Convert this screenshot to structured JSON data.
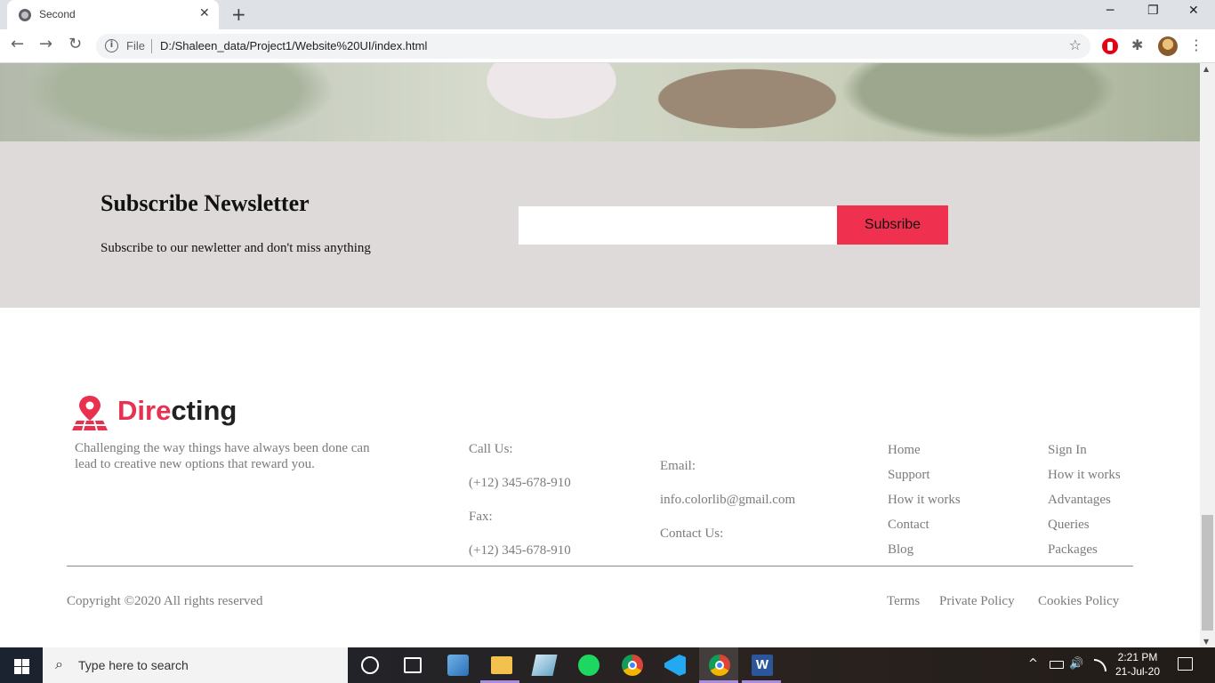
{
  "browser": {
    "tab_title": "Second",
    "tab_close": "✕",
    "new_tab": "+",
    "window": {
      "minimize": "─",
      "restore": "❐",
      "close": "✕"
    },
    "nav": {
      "back": "←",
      "forward": "→",
      "reload": "↻"
    },
    "address": {
      "scheme_label": "File",
      "url": "D:/Shaleen_data/Project1/Website%20UI/index.html",
      "star": "☆"
    },
    "extensions": {
      "puzzle": "✱",
      "menu": "⋮"
    }
  },
  "newsletter": {
    "title": "Subscribe Newsletter",
    "subtitle": "Subscribe to our newletter and don't miss anything",
    "input_value": "",
    "button_label": "Subsribe",
    "button_color": "#f0304f",
    "background": "#dedad9"
  },
  "footer": {
    "brand": {
      "part_accent": "Dire",
      "part_dark": "cting",
      "accent_color": "#e9304f"
    },
    "tagline": "Challenging the way things have always been done can lead to creative new options that reward you.",
    "call": {
      "label": "Call Us:",
      "phone": "(+12) 345-678-910",
      "fax_label": "Fax:",
      "fax": "(+12) 345-678-910"
    },
    "email": {
      "label": "Email:",
      "address": "info.colorlib@gmail.com",
      "contact_label": "Contact Us:"
    },
    "links_col1": [
      "Home",
      "Support",
      "How it works",
      "Contact",
      "Blog"
    ],
    "links_col2": [
      "Sign In",
      "How it works",
      "Advantages",
      "Queries",
      "Packages"
    ],
    "copyright": "Copyright ©2020 All rights reserved",
    "legal": [
      "Terms",
      "Private Policy",
      "Cookies Policy"
    ]
  },
  "taskbar": {
    "search_placeholder": "Type here to search",
    "time": "2:21 PM",
    "date": "21-Jul-20",
    "tray": {
      "chevron": "^",
      "volume": "🔊"
    }
  }
}
